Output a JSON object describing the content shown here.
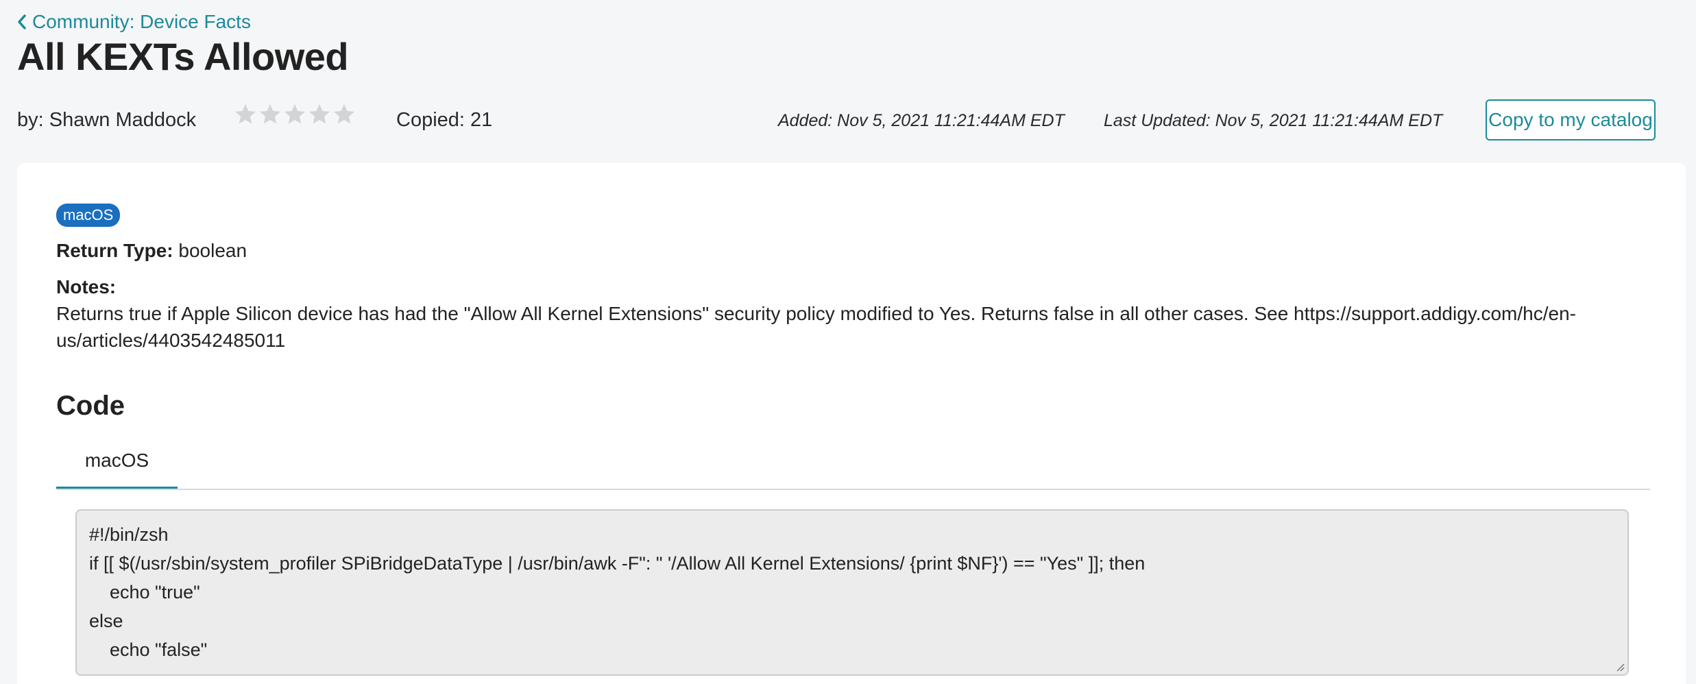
{
  "breadcrumb": {
    "label": "Community: Device Facts",
    "icon": "chevron-left-icon"
  },
  "page_title": "All KEXTs Allowed",
  "meta": {
    "author": "by: Shawn Maddock",
    "rating": 0,
    "rating_max": 5,
    "copied": "Copied: 21",
    "added": "Added: Nov 5, 2021 11:21:44AM EDT",
    "last_updated": "Last Updated: Nov 5, 2021 11:21:44AM EDT",
    "copy_button": "Copy to my catalog"
  },
  "details": {
    "os_badge": "macOS",
    "return_type_label": "Return Type:",
    "return_type_value": "boolean",
    "notes_label": "Notes:",
    "notes_text": "Returns true if Apple Silicon device has had the \"Allow All Kernel Extensions\" security policy modified to Yes. Returns false in all other cases. See https://support.addigy.com/hc/en-us/articles/4403542485011"
  },
  "code": {
    "heading": "Code",
    "tabs": [
      {
        "label": "macOS",
        "active": true
      }
    ],
    "lines": [
      "#!/bin/zsh",
      "if [[ $(/usr/sbin/system_profiler SPiBridgeDataType | /usr/bin/awk -F\": \" '/Allow All Kernel Extensions/ {print $NF}') == \"Yes\" ]]; then",
      "    echo \"true\"",
      "else",
      "    echo \"false\""
    ]
  },
  "colors": {
    "accent": "#1b8a9a",
    "badge": "#1a6fbf",
    "star_empty": "#d4d4d4",
    "background": "#f5f6f8"
  }
}
